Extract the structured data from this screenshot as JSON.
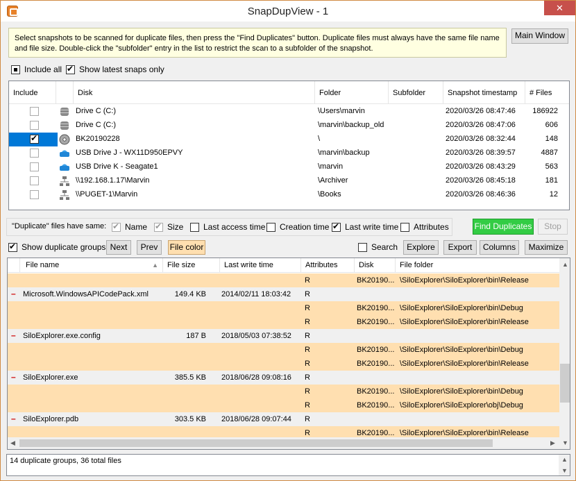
{
  "window": {
    "title": "SnapDupView - 1",
    "close": "✕"
  },
  "info_text": "Select snapshots to be scanned for duplicate files, then press the \"Find Duplicates\" button.  Duplicate files must always have the same file name and file size.  Double-click the \"subfolder\" entry in the list to restrict the scan to a subfolder of the snapshot.",
  "main_window_button": "Main Window",
  "include_all": {
    "label": "Include all",
    "state": "indeterminate"
  },
  "show_latest": {
    "label": "Show latest snaps only",
    "checked": true
  },
  "snap_table": {
    "columns": [
      "Include",
      "Disk",
      "Folder",
      "Subfolder",
      "Snapshot timestamp",
      "# Files"
    ],
    "rows": [
      {
        "included": false,
        "selected": false,
        "icon": "hard-drive-icon",
        "disk": "Drive C (C:)",
        "folder": "\\Users\\marvin",
        "subfolder": "",
        "timestamp": "2020/03/26 08:47:46",
        "files": "186922"
      },
      {
        "included": false,
        "selected": false,
        "icon": "hard-drive-icon",
        "disk": "Drive C (C:)",
        "folder": "\\marvin\\backup_old",
        "subfolder": "",
        "timestamp": "2020/03/26 08:47:06",
        "files": "606"
      },
      {
        "included": true,
        "selected": true,
        "icon": "disc-icon",
        "disk": "BK20190228",
        "folder": "\\",
        "subfolder": "",
        "timestamp": "2020/03/26 08:32:44",
        "files": "148"
      },
      {
        "included": false,
        "selected": false,
        "icon": "usb-drive-icon",
        "disk": "USB Drive J - WX11D950EPVY",
        "folder": "\\marvin\\backup",
        "subfolder": "",
        "timestamp": "2020/03/26 08:39:57",
        "files": "4887"
      },
      {
        "included": false,
        "selected": false,
        "icon": "usb-drive-icon",
        "disk": "USB Drive K - Seagate1",
        "folder": "\\marvin",
        "subfolder": "",
        "timestamp": "2020/03/26 08:43:29",
        "files": "563"
      },
      {
        "included": false,
        "selected": false,
        "icon": "network-icon",
        "disk": "\\\\192.168.1.17\\Marvin",
        "folder": "\\Archiver",
        "subfolder": "",
        "timestamp": "2020/03/26 08:45:18",
        "files": "181"
      },
      {
        "included": false,
        "selected": false,
        "icon": "network-icon",
        "disk": "\\\\PUGET-1\\Marvin",
        "folder": "\\Books",
        "subfolder": "",
        "timestamp": "2020/03/26 08:46:36",
        "files": "12"
      }
    ]
  },
  "duplicate_criteria": {
    "label": "\"Duplicate\" files have same:",
    "items": [
      {
        "label": "Name",
        "checked": true,
        "disabled": true
      },
      {
        "label": "Size",
        "checked": true,
        "disabled": true
      },
      {
        "label": "Last access time",
        "checked": false,
        "disabled": false
      },
      {
        "label": "Creation time",
        "checked": false,
        "disabled": false
      },
      {
        "label": "Last write time",
        "checked": true,
        "disabled": false
      },
      {
        "label": "Attributes",
        "checked": false,
        "disabled": false
      }
    ]
  },
  "buttons": {
    "find_duplicates": "Find Duplicates",
    "stop": "Stop",
    "next": "Next",
    "prev": "Prev",
    "file_color": "File color",
    "explore": "Explore",
    "export": "Export",
    "columns": "Columns",
    "maximize": "Maximize"
  },
  "show_groups": {
    "label": "Show duplicate groups",
    "checked": true
  },
  "search": {
    "label": "Search",
    "checked": false
  },
  "results": {
    "columns": [
      "File name",
      "File size",
      "Last write time",
      "Attributes",
      "Disk",
      "File folder"
    ],
    "rows": [
      {
        "type": "file",
        "name": "",
        "size": "",
        "time": "",
        "attr": "R",
        "disk": "BK20190...",
        "folder": "\\SiloExplorer\\SiloExplorer\\bin\\Release"
      },
      {
        "type": "group",
        "name": "Microsoft.WindowsAPICodePack.xml",
        "size": "149.4 KB",
        "time": "2014/02/11 18:03:42",
        "attr": "R",
        "disk": "",
        "folder": ""
      },
      {
        "type": "file",
        "name": "",
        "size": "",
        "time": "",
        "attr": "R",
        "disk": "BK20190...",
        "folder": "\\SiloExplorer\\SiloExplorer\\bin\\Debug"
      },
      {
        "type": "file",
        "name": "",
        "size": "",
        "time": "",
        "attr": "R",
        "disk": "BK20190...",
        "folder": "\\SiloExplorer\\SiloExplorer\\bin\\Release"
      },
      {
        "type": "group",
        "name": "SiloExplorer.exe.config",
        "size": "187 B",
        "time": "2018/05/03 07:38:52",
        "attr": "R",
        "disk": "",
        "folder": ""
      },
      {
        "type": "file",
        "name": "",
        "size": "",
        "time": "",
        "attr": "R",
        "disk": "BK20190...",
        "folder": "\\SiloExplorer\\SiloExplorer\\bin\\Debug"
      },
      {
        "type": "file",
        "name": "",
        "size": "",
        "time": "",
        "attr": "R",
        "disk": "BK20190...",
        "folder": "\\SiloExplorer\\SiloExplorer\\bin\\Release"
      },
      {
        "type": "group",
        "name": "SiloExplorer.exe",
        "size": "385.5 KB",
        "time": "2018/06/28 09:08:16",
        "attr": "R",
        "disk": "",
        "folder": ""
      },
      {
        "type": "file",
        "name": "",
        "size": "",
        "time": "",
        "attr": "R",
        "disk": "BK20190...",
        "folder": "\\SiloExplorer\\SiloExplorer\\bin\\Debug"
      },
      {
        "type": "file",
        "name": "",
        "size": "",
        "time": "",
        "attr": "R",
        "disk": "BK20190...",
        "folder": "\\SiloExplorer\\SiloExplorer\\obj\\Debug"
      },
      {
        "type": "group",
        "name": "SiloExplorer.pdb",
        "size": "303.5 KB",
        "time": "2018/06/28 09:07:44",
        "attr": "R",
        "disk": "",
        "folder": ""
      },
      {
        "type": "file",
        "name": "",
        "size": "",
        "time": "",
        "attr": "R",
        "disk": "BK20190...",
        "folder": "\\SiloExplorer\\SiloExplorer\\bin\\Release"
      }
    ]
  },
  "status_text": "14 duplicate groups, 36 total files",
  "colors": {
    "file_row": "#ffdfb0",
    "group_row": "#f0f0f0",
    "selected": "#0078d7",
    "find_button": "#33cc44",
    "close_button": "#c7504b"
  }
}
